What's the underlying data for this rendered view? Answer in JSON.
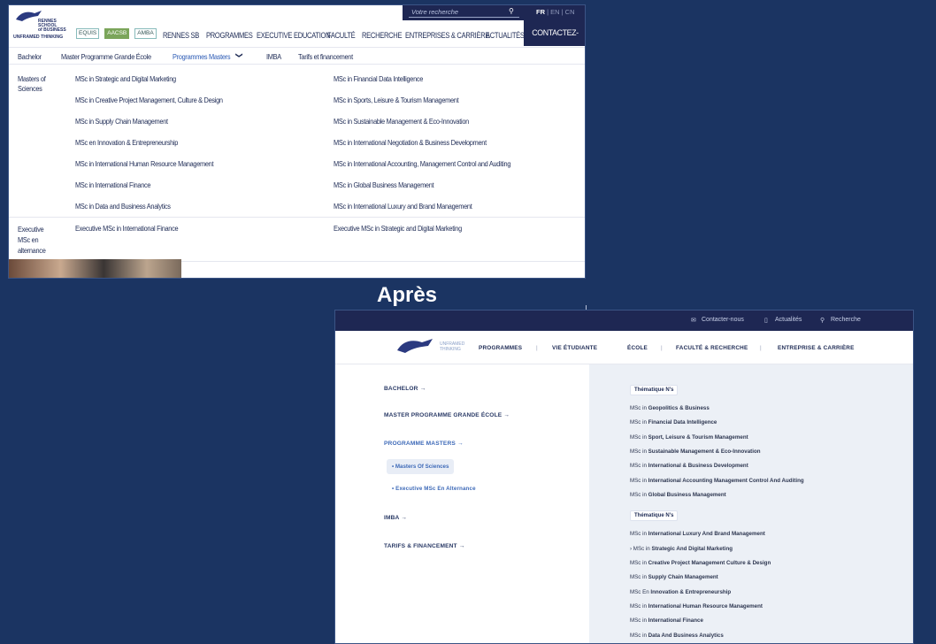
{
  "before": {
    "search_placeholder": "Votre recherche",
    "lang_active": "FR",
    "lang_others": "| EN | CN",
    "logo_lines": [
      "RENNES",
      "SCHOOL",
      "of BUSINESS"
    ],
    "tagline": "UNFRAMED THINKING",
    "badges": [
      "EQUIS",
      "AACSB",
      "AMBA"
    ],
    "nav": [
      "RENNES SB",
      "PROGRAMMES",
      "EXECUTIVE EDUCATION",
      "FACULTÉ",
      "RECHERCHE",
      "ENTREPRISES & CARRIÈRE",
      "ACTUALITÉS"
    ],
    "contact": "CONTACTEZ-NOUS",
    "subnav": [
      "Bachelor",
      "Master Programme Grande École",
      "Programmes Masters",
      "IMBA",
      "Tarifs et financement"
    ],
    "chevron": "❯",
    "group1": "Masters of Sciences",
    "col1": [
      "MSc in Strategic and Digital Marketing",
      "MSc in Creative Project Management, Culture & Design",
      "MSc in Supply Chain Management",
      "MSc en Innovation & Entrepreneurship",
      "MSc in International Human Resource Management",
      "MSc in International Finance",
      "MSc in Data and Business Analytics"
    ],
    "col2": [
      "MSc in Financial Data Intelligence",
      "MSc in Sports, Leisure & Tourism Management",
      "MSc in Sustainable Management & Eco-Innovation",
      "MSc in International Negotiation & Business Development",
      "MSc in International Accounting, Management Control and Auditing",
      "MSc in Global Business Management",
      "MSc in International Luxury and Brand Management"
    ],
    "group2": "Executive MSc en alternance",
    "exec1": "Executive MSc in International Finance",
    "exec2": "Executive MSc in Strategic and Digital Marketing"
  },
  "label": "Après",
  "after": {
    "top": [
      "Contacter-nous",
      "Actualités",
      "Recherche"
    ],
    "top_icons": [
      "mail-icon",
      "document-icon",
      "search-icon"
    ],
    "tagline": [
      "UNFRAMED",
      "THINKING"
    ],
    "nav": [
      "PROGRAMMES",
      "VIE ÉTUDIANTE",
      "ÉCOLE",
      "FACULTÉ & RECHERCHE",
      "ENTREPRISE & CARRIÈRE"
    ],
    "side": [
      "BACHELOR",
      "MASTER PROGRAMME GRANDE ÉCOLE",
      "PROGRAMME MASTERS",
      "IMBA",
      "TARIFS & FINANCEMENT"
    ],
    "arrow": "→",
    "sub": [
      "• Masters Of Sciences",
      "• Executive MSc En Alternance"
    ],
    "tag": "Thématique N's",
    "list1": [
      "Geopolitics & Business",
      "Financial Data Intelligence",
      "Sport, Leisure & Tourism Management",
      "Sustainable Management & Eco-Innovation",
      "International & Business Development",
      "International Accounting Management Control And Auditing",
      "Global Business Management"
    ],
    "list2": [
      "International Luxury And Brand Management",
      "Strategic And Digital Marketing",
      "Creative Project Management Culture & Design",
      "Supply Chain Management",
      "Innovation & Entrepreneurship",
      "International Human Resource Management",
      "International Finance",
      "Data And Business Analytics"
    ],
    "prefix": "MSc in",
    "prefix_en": "MSc En",
    "bullet": "›"
  }
}
